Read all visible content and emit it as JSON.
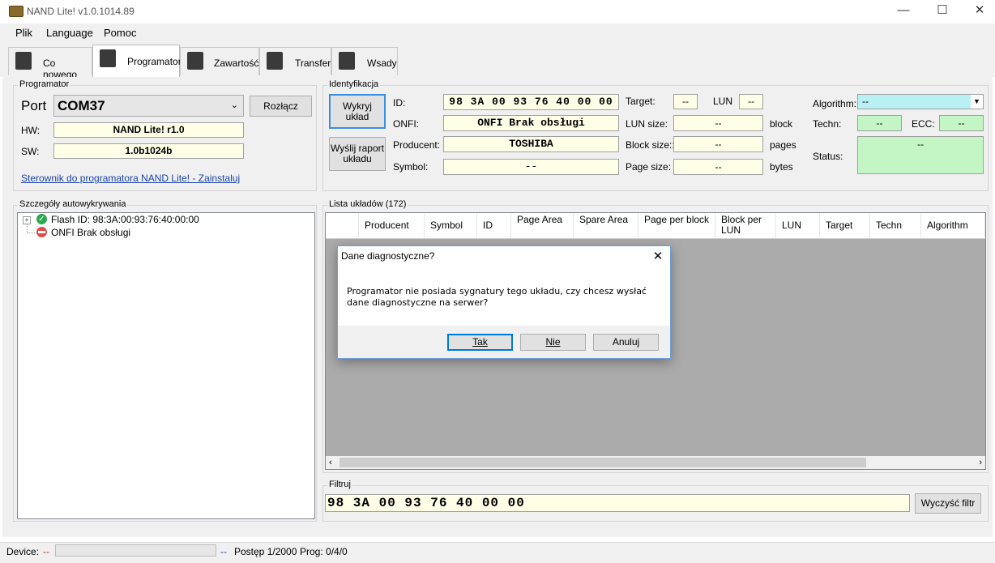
{
  "window": {
    "title": "NAND Lite! v1.0.1014.89",
    "minimize": "—",
    "maximize": "☐",
    "close": "✕"
  },
  "menu": [
    "Plik",
    "Language",
    "Pomoc"
  ],
  "tabs": [
    "Co nowego",
    "Programator",
    "Zawartość",
    "Transfer",
    "Wsady"
  ],
  "programator": {
    "group_title": "Programator",
    "port_label": "Port",
    "port_value": "COM37",
    "disconnect_button": "Rozłącz",
    "hw_label": "HW:",
    "hw_value": "NAND Lite! r1.0",
    "sw_label": "SW:",
    "sw_value": "1.0b1024b",
    "driver_link": "Sterownik do programatora NAND Lite! - Zainstaluj"
  },
  "identification": {
    "group_title": "Identyfikacja",
    "detect_button": "Wykryj układ",
    "report_button": "Wyślij raport układu",
    "id_label": "ID:",
    "id_value": "98 3A 00 93 76 40 00 00",
    "onfi_label": "ONFI:",
    "onfi_value": "ONFI Brak obsługi",
    "producer_label": "Producent:",
    "producer_value": "TOSHIBA",
    "symbol_label": "Symbol:",
    "symbol_value": "--",
    "target_label": "Target:",
    "target_value": "--",
    "lun_label": "LUN",
    "lun_value": "--",
    "lun_size_label": "LUN size:",
    "lun_size_value": "--",
    "lun_size_unit": "block",
    "block_size_label": "Block size::",
    "block_size_value": "--",
    "block_size_unit": "pages",
    "page_size_label": "Page size:",
    "page_size_value": "--",
    "page_size_unit": "bytes",
    "algorithm_label": "Algorithm:",
    "algorithm_value": "--",
    "techn_label": "Techn:",
    "techn_value": "--",
    "ecc_label": "ECC:",
    "ecc_value": "--",
    "status_label": "Status:",
    "status_value": "--"
  },
  "autodetect": {
    "group_title": "Szczegóły autowykrywania",
    "items": [
      "Flash ID: 98:3A:00:93:76:40:00:00",
      "ONFI Brak obsługi"
    ]
  },
  "chip_list": {
    "group_title": "Lista układów (172)",
    "columns": [
      "Producent",
      "Symbol",
      "ID",
      "Page Area",
      "Spare Area",
      "Page per block",
      "Block per LUN",
      "LUN",
      "Target",
      "Techn",
      "Algorithm"
    ]
  },
  "filter": {
    "group_title": "Filtruj",
    "value": "98 3A 00 93 76 40 00 00",
    "clear_button": "Wyczyść filtr"
  },
  "status_bar": {
    "device_label": "Device:",
    "device_value": "--",
    "progress_value": 0,
    "progress_text": "--",
    "progress_label": "Postęp 1/2000",
    "prog_label": "Prog: 0/4/0"
  },
  "dialog": {
    "title": "Dane diagnostyczne?",
    "message": "Programator nie posiada sygnatury tego układu, czy chcesz wysłać dane diagnostyczne na serwer?",
    "yes": "Tak",
    "no": "Nie",
    "cancel": "Anuluj"
  },
  "colors": {
    "field_yellow": "#ffffe8",
    "field_green": "#c4f5c4",
    "field_cyan": "#b8f0f4",
    "link": "#1a44aa",
    "dialog_border": "#6f9fd8"
  }
}
